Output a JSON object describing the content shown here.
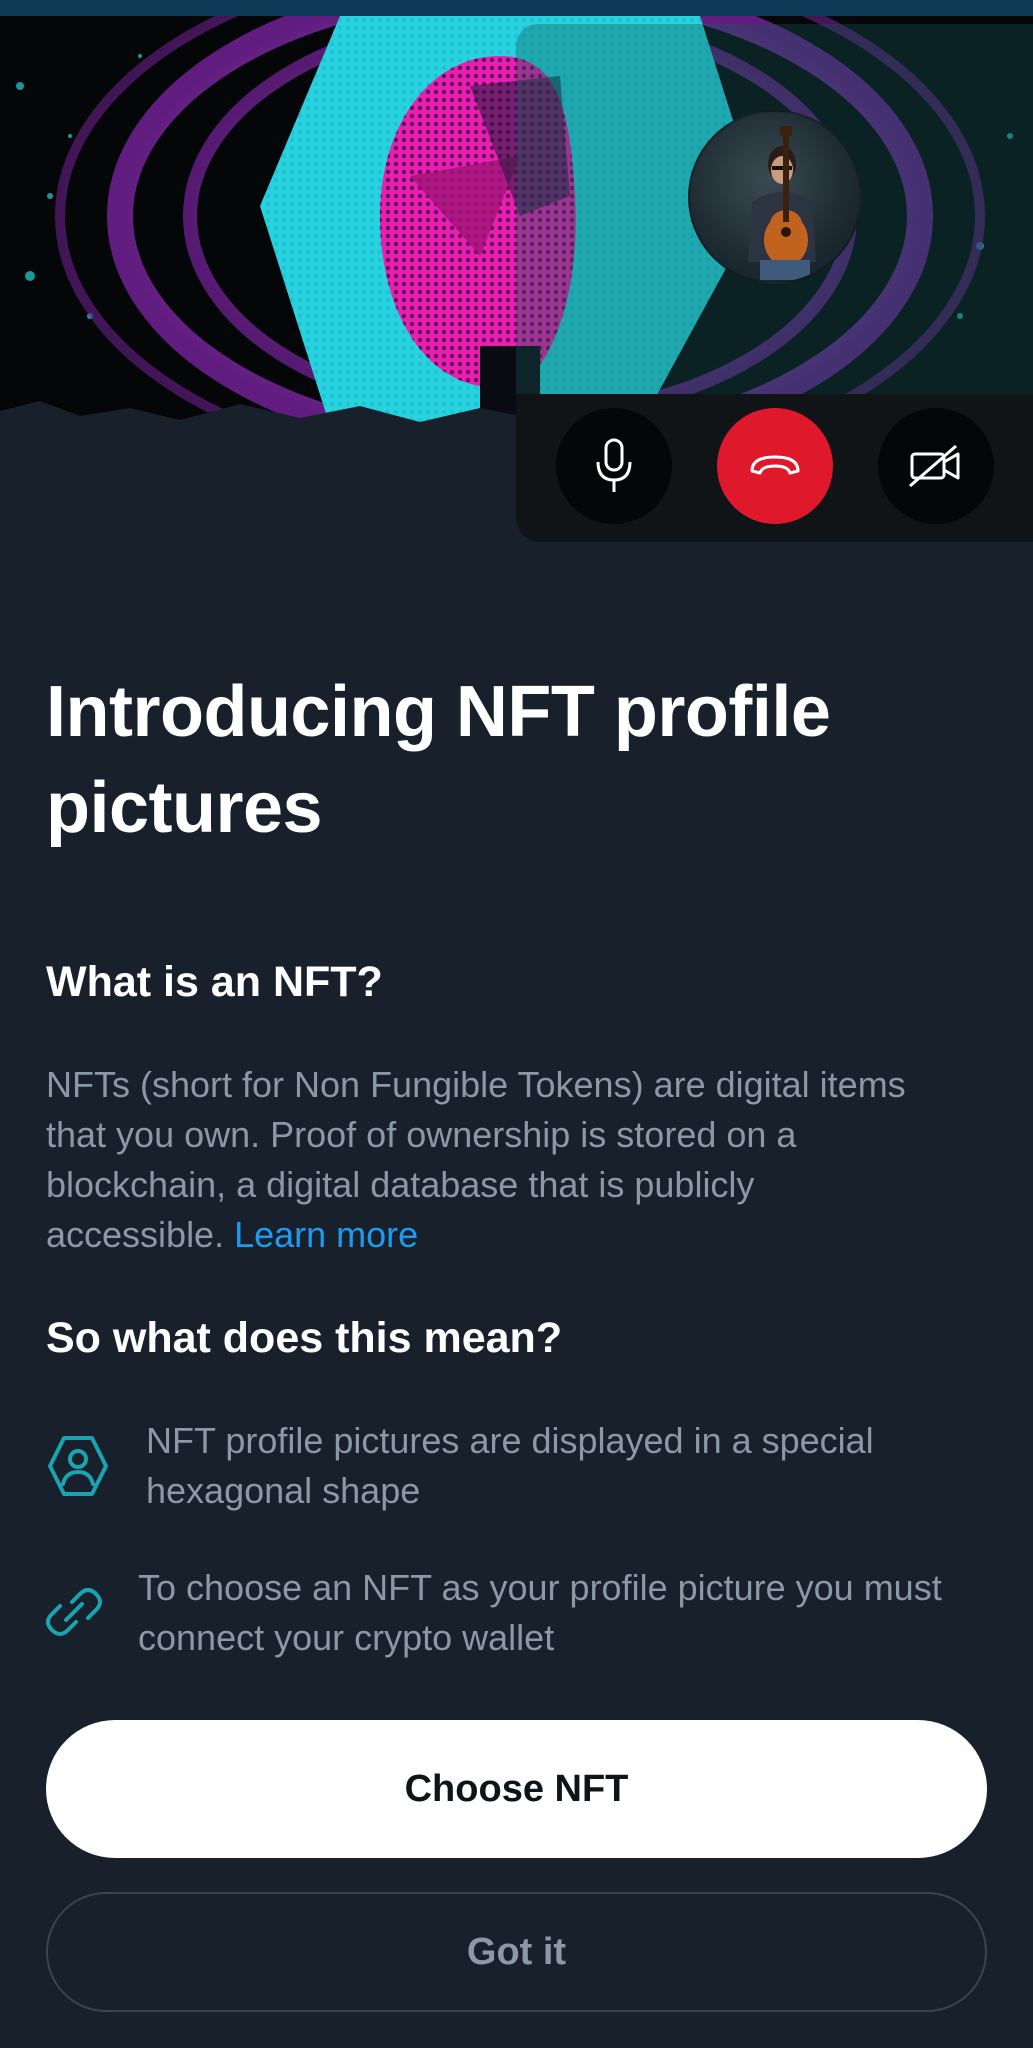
{
  "hero": {
    "artwork_icon": "nft-halftone-head-artwork",
    "colors": {
      "cyan": "#27d3e0",
      "magenta": "#e81fb4",
      "purple": "#9b3fc9",
      "black": "#050607"
    }
  },
  "call": {
    "avatar_icon": "guitarist-avatar",
    "mic_icon": "microphone-icon",
    "hangup_icon": "phone-hangup-icon",
    "video_icon": "video-off-icon",
    "hangup_color": "#e0182c"
  },
  "content": {
    "title": "Introducing NFT profile pictures",
    "what_heading": "What is an NFT?",
    "what_body": "NFTs (short for Non Fungible Tokens) are digital items that you own. Proof of ownership is stored on a blockchain, a digital database that is publicly accessible. ",
    "learn_more": "Learn more",
    "mean_heading": "So what does this mean?",
    "features": [
      {
        "icon": "hexagon-profile-icon",
        "text": "NFT profile pictures are displayed in a special hexagonal shape"
      },
      {
        "icon": "link-icon",
        "text": "To choose an NFT as your profile picture you must connect your crypto wallet"
      }
    ],
    "accent_color": "#1d9bf0",
    "icon_color": "#1aa3b0"
  },
  "actions": {
    "primary_label": "Choose NFT",
    "secondary_label": "Got it"
  }
}
